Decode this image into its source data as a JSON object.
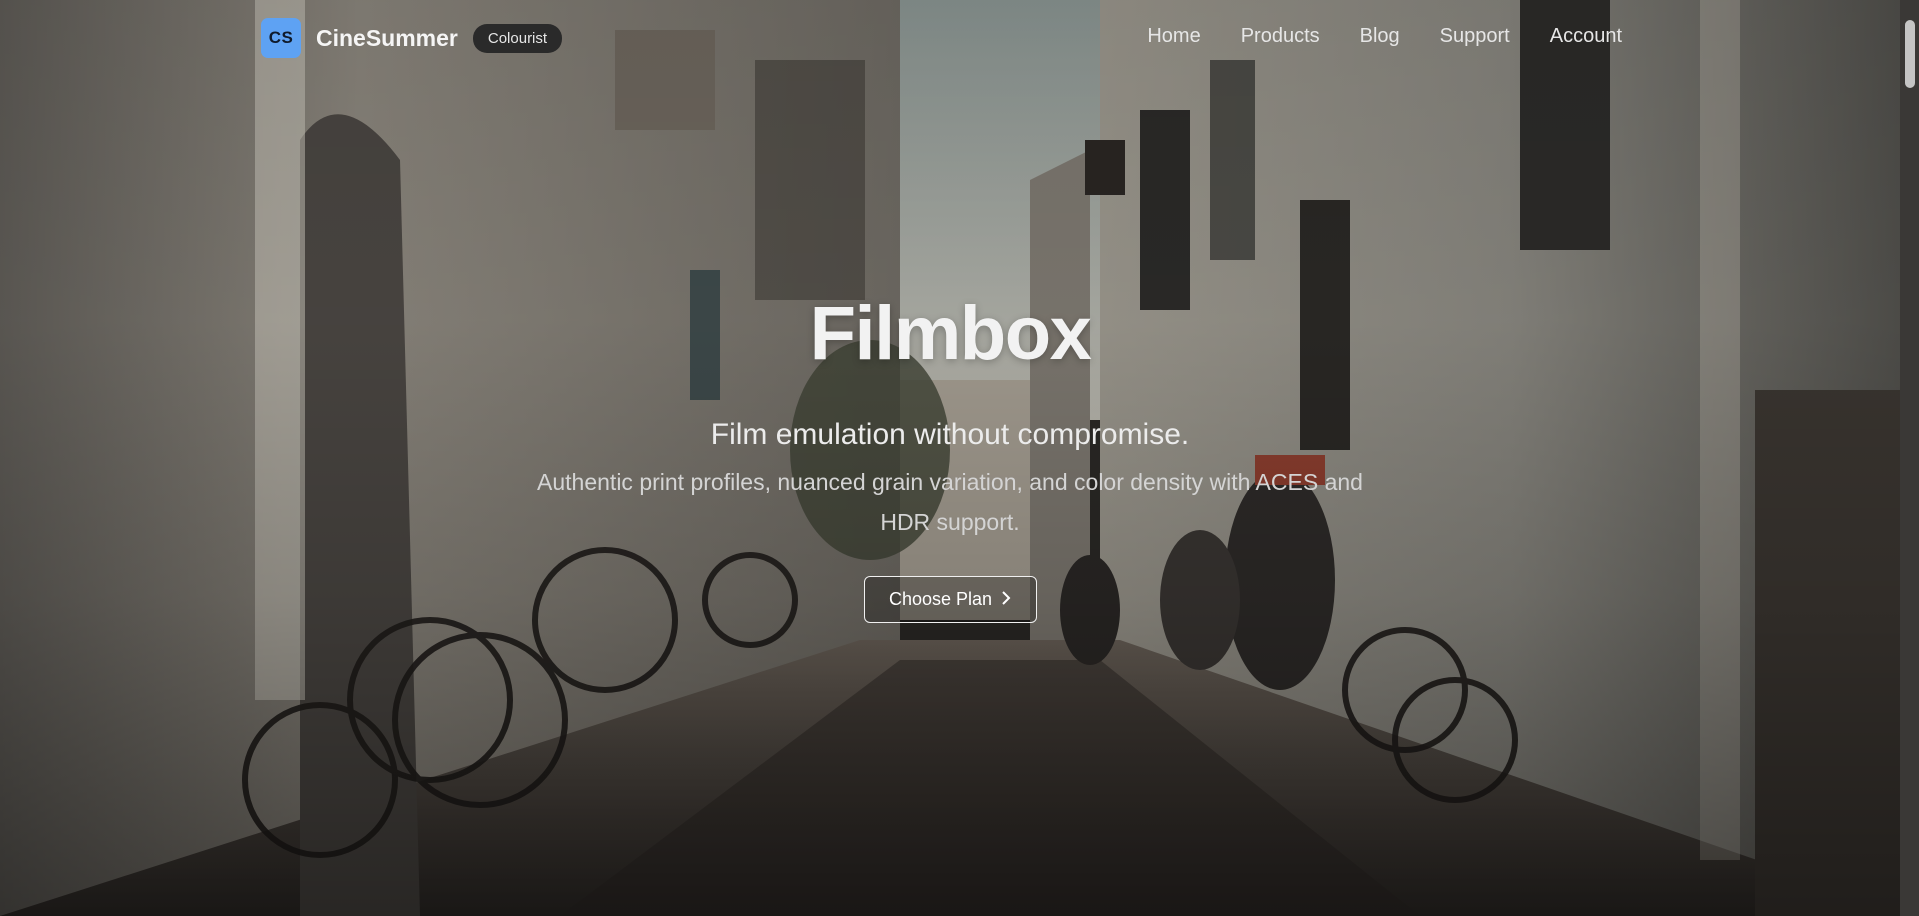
{
  "brand": {
    "logo_text": "CS",
    "name": "CineSummer",
    "badge": "Colourist",
    "logo_color": "#5ea2f3"
  },
  "nav": {
    "items": [
      {
        "label": "Home"
      },
      {
        "label": "Products"
      },
      {
        "label": "Blog"
      },
      {
        "label": "Support"
      },
      {
        "label": "Account"
      }
    ]
  },
  "hero": {
    "title": "Filmbox",
    "subtitle": "Film emulation without compromise.",
    "description": "Authentic print profiles, nuanced grain variation, and color density with ACES and HDR support.",
    "cta_label": "Choose Plan",
    "cta_icon": "chevron-right-icon",
    "background": "narrow-alley-with-bicycles-photo"
  }
}
